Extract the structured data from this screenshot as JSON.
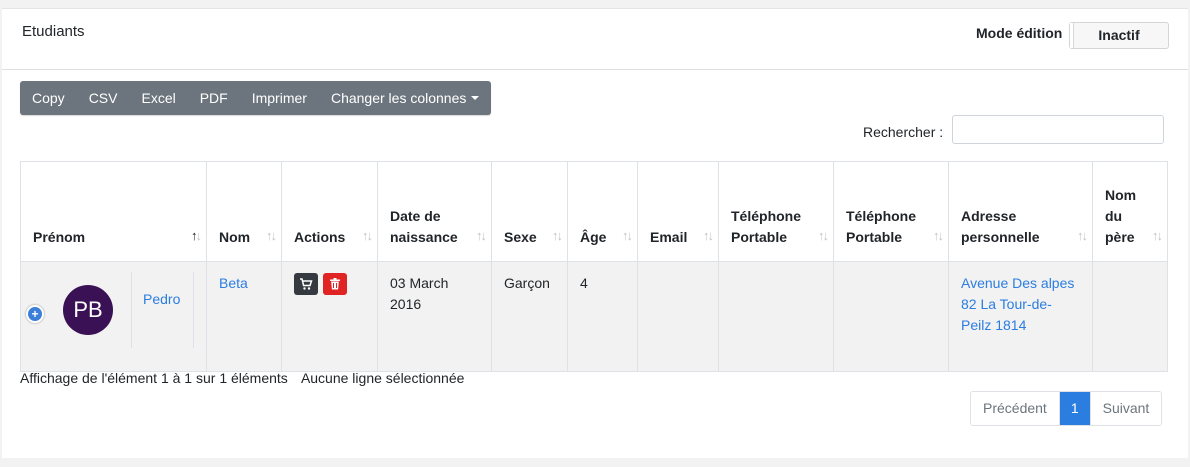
{
  "header": {
    "title": "Etudiants",
    "mode_label": "Mode édition",
    "mode_value": "Inactif"
  },
  "toolbar": {
    "buttons": [
      "Copy",
      "CSV",
      "Excel",
      "PDF",
      "Imprimer",
      "Changer les colonnes"
    ]
  },
  "search": {
    "label": "Rechercher :",
    "value": ""
  },
  "table": {
    "columns": [
      {
        "line1": "Prénom",
        "line2": "",
        "line3": ""
      },
      {
        "line1": "Nom",
        "line2": "",
        "line3": ""
      },
      {
        "line1": "Actions",
        "line2": "",
        "line3": ""
      },
      {
        "line1": "Date de",
        "line2": "naissance",
        "line3": ""
      },
      {
        "line1": "Sexe",
        "line2": "",
        "line3": ""
      },
      {
        "line1": "Âge",
        "line2": "",
        "line3": ""
      },
      {
        "line1": "Email",
        "line2": "",
        "line3": ""
      },
      {
        "line1": "Téléphone",
        "line2": "Portable",
        "line3": ""
      },
      {
        "line1": "Téléphone",
        "line2": "Portable",
        "line3": ""
      },
      {
        "line1": "Adresse",
        "line2": "personnelle",
        "line3": ""
      },
      {
        "line1": "Nom",
        "line2": "du",
        "line3": "père"
      }
    ],
    "sorted_column": "Prénom",
    "sort_direction": "ascending",
    "rows": [
      {
        "avatar_initials": "PB",
        "avatar_color": "#3b1155",
        "prenom": "Pedro",
        "nom": "Beta",
        "actions": [
          "cart-icon",
          "trash-icon"
        ],
        "date_line1": "03 March",
        "date_line2": "2016",
        "sexe": "Garçon",
        "age": "4",
        "email": "",
        "tel1": "",
        "tel2": "",
        "adresse_line1": "Avenue Des alpes",
        "adresse_line2": "82 La Tour-de-",
        "adresse_line3": "Peilz 1814",
        "pere": ""
      }
    ]
  },
  "footer": {
    "info": "Affichage de l'élément 1 à 1 sur 1 éléments",
    "selection": "Aucune ligne sélectionnée"
  },
  "pagination": {
    "previous": "Précédent",
    "current": "1",
    "next": "Suivant"
  },
  "colors": {
    "accent": "#2b7de0",
    "toolbar": "#6c757d",
    "delete": "#e02424",
    "dark_button": "#343a40"
  }
}
